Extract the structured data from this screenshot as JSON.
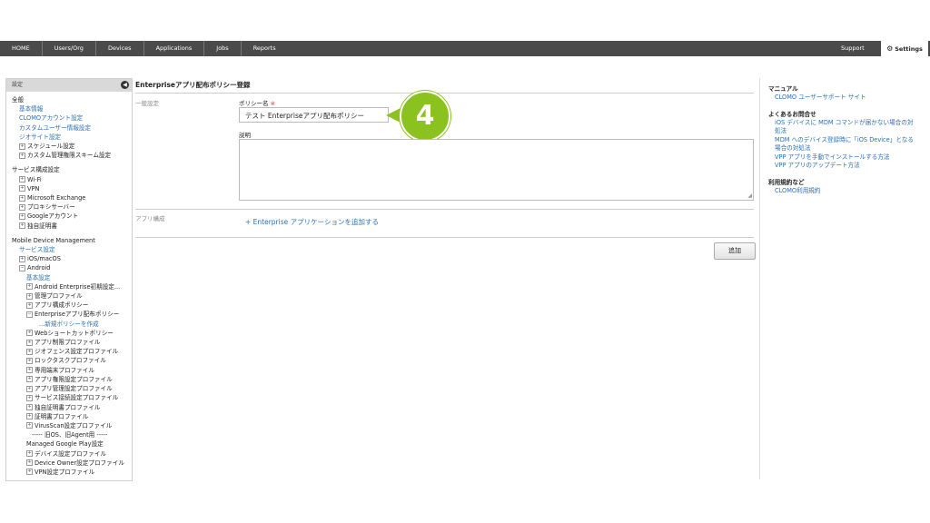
{
  "nav": {
    "items": [
      "HOME",
      "Users/Org",
      "Devices",
      "Applications",
      "Jobs",
      "Reports"
    ],
    "support": "Support",
    "settings": "Settings"
  },
  "sidebar": {
    "header": "設定",
    "tree": [
      {
        "t": "全般",
        "k": "sec"
      },
      {
        "t": "基本情報",
        "k": "lnk"
      },
      {
        "t": "CLOMOアカウント設定",
        "k": "lnk"
      },
      {
        "t": "カスタムユーザー情報設定",
        "k": "lnk"
      },
      {
        "t": "ジオサイト設定",
        "k": "lnk"
      },
      {
        "t": "スケジュール設定",
        "k": "sub",
        "p": true
      },
      {
        "t": "カスタム管理権限スキーム設定",
        "k": "sub",
        "p": true
      },
      {
        "t": "サービス構成設定",
        "k": "sec"
      },
      {
        "t": "Wi-Fi",
        "k": "sub",
        "p": true
      },
      {
        "t": "VPN",
        "k": "sub",
        "p": true
      },
      {
        "t": "Microsoft Exchange",
        "k": "sub",
        "p": true
      },
      {
        "t": "プロキシサーバー",
        "k": "sub",
        "p": true
      },
      {
        "t": "Googleアカウント",
        "k": "sub",
        "p": true
      },
      {
        "t": "独自証明書",
        "k": "sub",
        "p": true
      },
      {
        "t": "Mobile Device Management",
        "k": "sec"
      },
      {
        "t": "サービス設定",
        "k": "lnk"
      },
      {
        "t": "iOS/macOS",
        "k": "sub",
        "p": true
      },
      {
        "t": "Android",
        "k": "sub",
        "p": true,
        "m": true
      },
      {
        "t": "基本設定",
        "k": "lnk3"
      },
      {
        "t": "Android Enterprise初期設定...",
        "k": "sub2",
        "p": true
      },
      {
        "t": "管理プロファイル",
        "k": "sub2",
        "p": true
      },
      {
        "t": "アプリ構成ポリシー",
        "k": "sub2",
        "p": true
      },
      {
        "t": "Enterpriseアプリ配布ポリシー",
        "k": "sub2",
        "p": true,
        "m": true
      },
      {
        "t": "...新規ポリシーを作成",
        "k": "lnk4"
      },
      {
        "t": "Webショートカットポリシー",
        "k": "sub2",
        "p": true
      },
      {
        "t": "アプリ制限プロファイル",
        "k": "sub2",
        "p": true
      },
      {
        "t": "ジオフェンス設定プロファイル",
        "k": "sub2",
        "p": true
      },
      {
        "t": "ロックタスクプロファイル",
        "k": "sub2",
        "p": true
      },
      {
        "t": "専用端末プロファイル",
        "k": "sub2",
        "p": true
      },
      {
        "t": "アプリ権限設定プロファイル",
        "k": "sub2",
        "p": true
      },
      {
        "t": "アプリ管理設定プロファイル",
        "k": "sub2",
        "p": true
      },
      {
        "t": "サービス接続設定プロファイル",
        "k": "sub2",
        "p": true
      },
      {
        "t": "独自証明書プロファイル",
        "k": "sub2",
        "p": true
      },
      {
        "t": "証明書プロファイル",
        "k": "sub2",
        "p": true
      },
      {
        "t": "VirusScan設定プロファイル",
        "k": "sub2",
        "p": true
      },
      {
        "t": "----- 旧OS、旧Agent用 -----",
        "k": "sub3"
      },
      {
        "t": "Managed Google Play設定",
        "k": "sub2"
      },
      {
        "t": "デバイス設定プロファイル",
        "k": "sub2",
        "p": true
      },
      {
        "t": "Device Owner設定プロファイル",
        "k": "sub2",
        "p": true
      },
      {
        "t": "VPN設定プロファイル",
        "k": "sub2",
        "p": true
      }
    ]
  },
  "main": {
    "title": "Enterpriseアプリ配布ポリシー登録",
    "general_label": "一般設定",
    "policy_name_label": "ポリシー名",
    "required_mark": "※",
    "policy_name_value": "テスト Enterpriseアプリ配布ポリシー",
    "description_label": "説明",
    "description_value": "",
    "app_config_label": "アプリ構成",
    "add_app_link": "+ Enterprise アプリケーションを追加する",
    "add_button": "追加",
    "step_badge": "4"
  },
  "right": {
    "manual_heading": "マニュアル",
    "manual_link": "CLOMO ユーザーサポート サイト",
    "faq_heading": "よくあるお問合せ",
    "faq_links": [
      "iOS デバイスに MDM コマンドが届かない場合の対",
      "処法",
      "MDM へのデバイス登録時に「iOS Device」となる",
      "場合の対処法",
      "VPP アプリを手動でインストールする方法",
      "VPP アプリのアップデート方法"
    ],
    "terms_heading": "利用規約など",
    "terms_link": "CLOMO利用規約"
  },
  "colors": {
    "topbar": "#4a4a4a",
    "link": "#2a6fb6",
    "badge": "#8cc21f"
  },
  "icons": {
    "settings": "gear-icon",
    "collapse": "chevron-left-icon"
  }
}
